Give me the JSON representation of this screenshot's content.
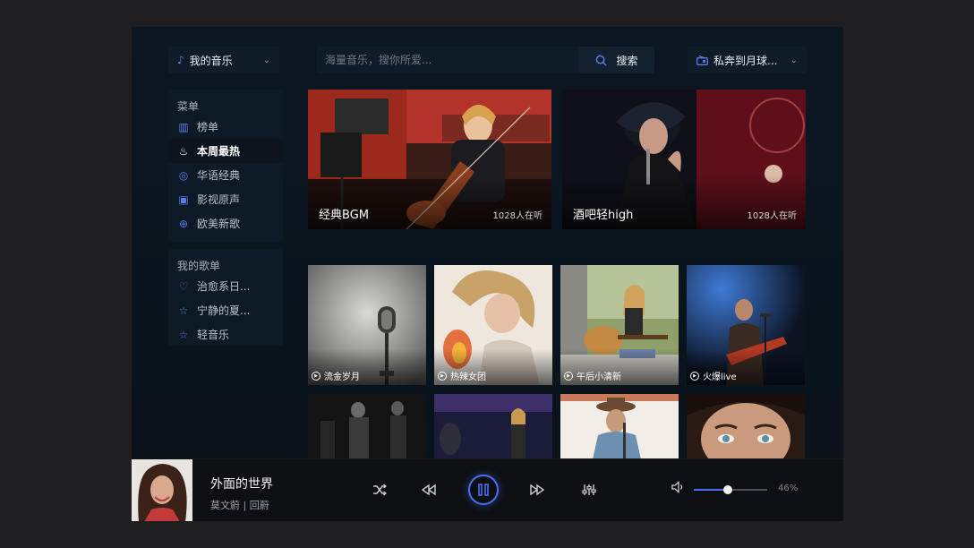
{
  "header": {
    "music_select": {
      "label": "我的音乐",
      "icon": "music-note-icon"
    },
    "search": {
      "placeholder": "海量音乐，搜你所爱...",
      "button_label": "搜索"
    },
    "radio_select": {
      "label": "私奔到月球...",
      "icon": "radio-icon"
    }
  },
  "sidebar": {
    "menu": {
      "title": "菜单",
      "items": [
        {
          "label": "榜单",
          "icon": "chart-bars-icon",
          "active": false
        },
        {
          "label": "本周最热",
          "icon": "fire-icon",
          "active": true
        },
        {
          "label": "华语经典",
          "icon": "disc-icon",
          "active": false
        },
        {
          "label": "影视原声",
          "icon": "tv-icon",
          "active": false
        },
        {
          "label": "欧美新歌",
          "icon": "globe-icon",
          "active": false
        }
      ]
    },
    "playlists": {
      "title": "我的歌单",
      "items": [
        {
          "label": "治愈系日...",
          "icon": "heart-icon"
        },
        {
          "label": "宁静的夏...",
          "icon": "star-icon"
        },
        {
          "label": "轻音乐",
          "icon": "star-icon"
        }
      ]
    }
  },
  "banners": [
    {
      "title": "经典BGM",
      "listeners": "1028人在听"
    },
    {
      "title": "酒吧轻high",
      "listeners": "1028人在听"
    }
  ],
  "tiles": [
    {
      "title": "流金岁月"
    },
    {
      "title": "热辣女团"
    },
    {
      "title": "午后小清新"
    },
    {
      "title": "火爆live"
    }
  ],
  "player": {
    "song_title": "外面的世界",
    "artist": "莫文蔚 | 回蔚",
    "volume": 0.46,
    "volume_text": "46%"
  },
  "colors": {
    "accent": "#4b6ef5",
    "background": "#0b151f"
  }
}
